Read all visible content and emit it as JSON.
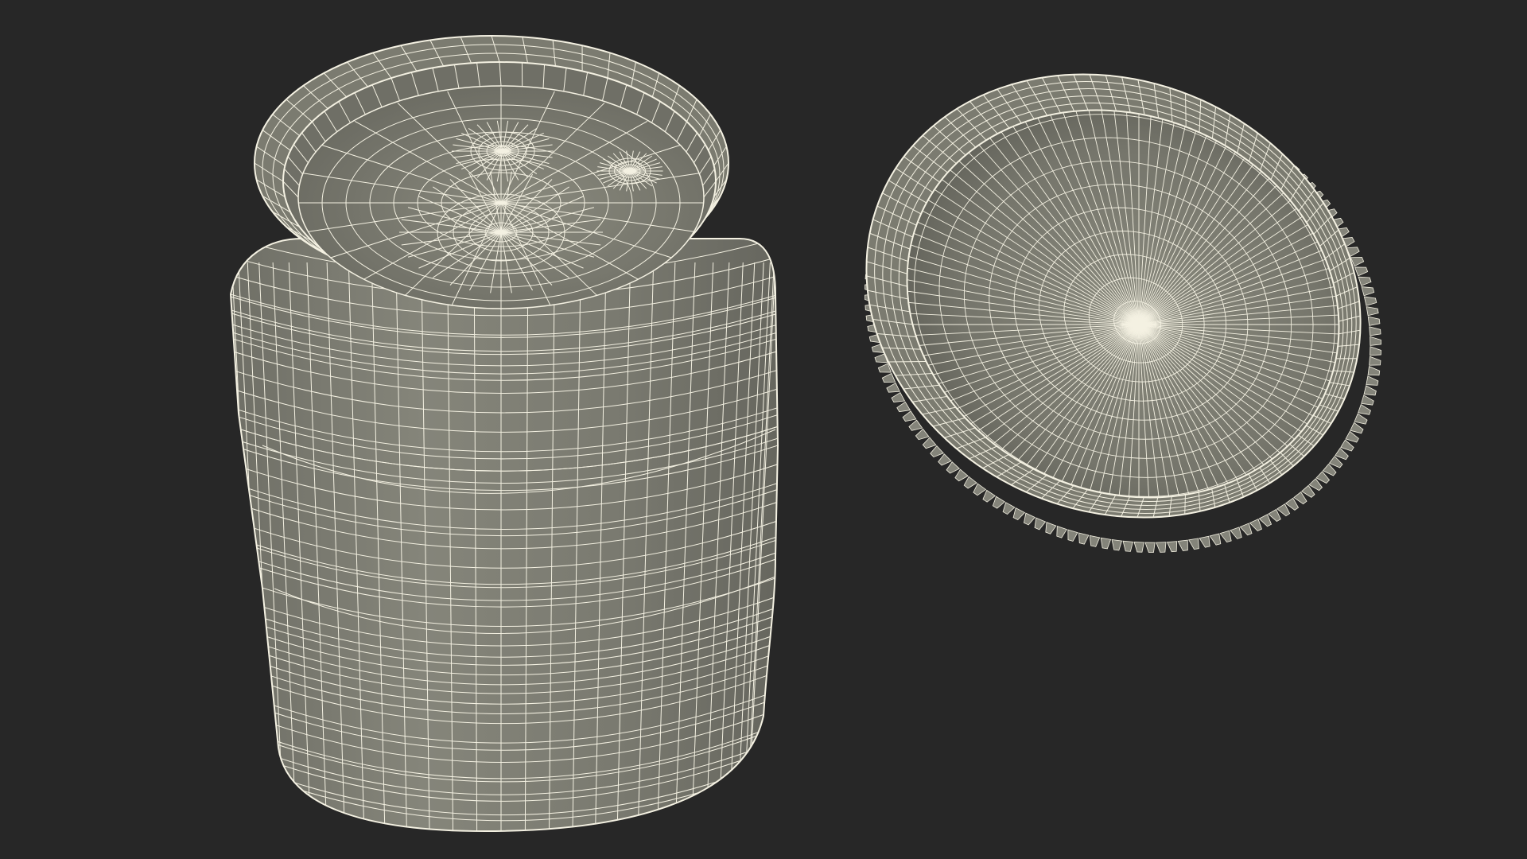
{
  "scene": {
    "background_color": "#272727",
    "shade_color": "#7b7b70",
    "shade_dark": "#5f5f57",
    "shade_light": "#8c8c80",
    "wire_color": "#f4f1e2",
    "objects": [
      {
        "name": "jar-body",
        "kind": "container-jar",
        "view": "top-open"
      },
      {
        "name": "jar-lid",
        "kind": "screw-cap",
        "view": "interior-up"
      }
    ]
  }
}
